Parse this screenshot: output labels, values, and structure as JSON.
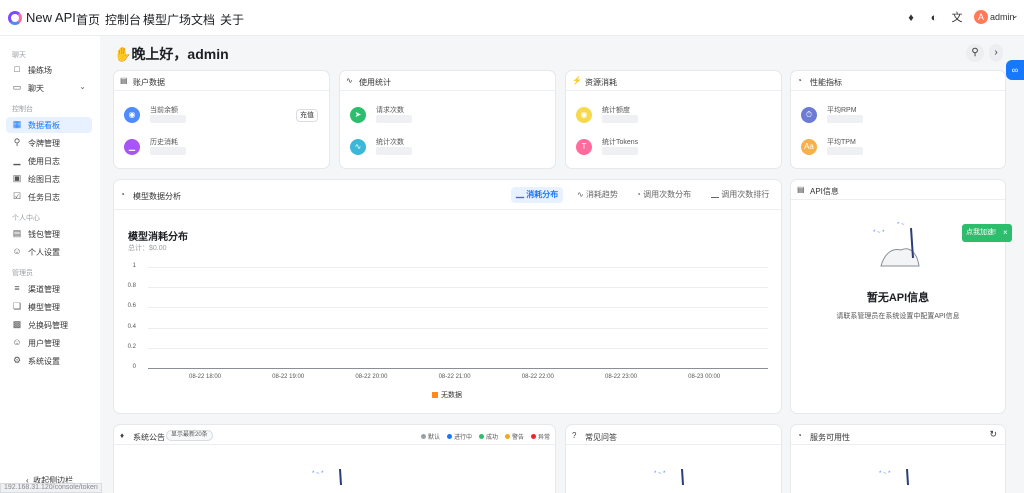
{
  "header": {
    "brand": "New API",
    "nav": [
      "首页",
      "控制台",
      "模型广场",
      "文档",
      "关于"
    ],
    "user": {
      "avatar_letter": "A",
      "name": "admin"
    },
    "icons": [
      "bell-icon",
      "theme-icon",
      "language-icon"
    ]
  },
  "sidebar": {
    "sections": [
      "聊天",
      "控制台",
      "个人中心",
      "管理员"
    ],
    "items": [
      {
        "label": "操练场",
        "icon": "playground-icon"
      },
      {
        "label": "聊天",
        "icon": "chat-icon"
      },
      {
        "label": "数据看板",
        "icon": "dashboard-icon",
        "active": true
      },
      {
        "label": "令牌管理",
        "icon": "key-icon"
      },
      {
        "label": "使用日志",
        "icon": "chart-icon"
      },
      {
        "label": "绘图日志",
        "icon": "image-icon"
      },
      {
        "label": "任务日志",
        "icon": "task-icon"
      },
      {
        "label": "钱包管理",
        "icon": "wallet-icon"
      },
      {
        "label": "个人设置",
        "icon": "user-icon"
      },
      {
        "label": "渠道管理",
        "icon": "layers-icon"
      },
      {
        "label": "模型管理",
        "icon": "box-icon"
      },
      {
        "label": "兑换码管理",
        "icon": "gift-icon"
      },
      {
        "label": "用户管理",
        "icon": "user-icon"
      },
      {
        "label": "系统设置",
        "icon": "gear-icon"
      }
    ],
    "collapse_label": "收起侧边栏",
    "url_tooltip": "192.168.31.120/console/token"
  },
  "greeting": "晚上好，admin",
  "cards": {
    "account": {
      "title": "账户数据",
      "stats": [
        "当前余额",
        "历史消耗"
      ],
      "recharge": "充值"
    },
    "usage": {
      "title": "使用统计",
      "stats": [
        "请求次数",
        "统计次数"
      ]
    },
    "resource": {
      "title": "资源消耗",
      "stats": [
        "统计额度",
        "统计Tokens"
      ]
    },
    "performance": {
      "title": "性能指标",
      "stats": [
        "平均RPM",
        "平均TPM"
      ]
    }
  },
  "analysis": {
    "title": "模型数据分析",
    "tabs": [
      "消耗分布",
      "消耗趋势",
      "调用次数分布",
      "调用次数排行"
    ],
    "active_tab": 0
  },
  "chart_data": {
    "type": "line",
    "title": "模型消耗分布",
    "subtitle": "总计：$0.00",
    "x": [
      "08-22 18:00",
      "08-22 19:00",
      "08-22 20:00",
      "08-22 21:00",
      "08-22 22:00",
      "08-22 23:00",
      "08-23 00:00"
    ],
    "y_ticks": [
      "1",
      "0.8",
      "0.6",
      "0.4",
      "0.2",
      "0"
    ],
    "ylim": [
      0,
      1
    ],
    "grid": true,
    "legend": [
      "无数据"
    ],
    "legend_position": "bottom",
    "series": [
      {
        "name": "无数据",
        "color": "#ff8c1a",
        "values": []
      }
    ]
  },
  "api_info": {
    "title": "API信息",
    "empty_title": "暂无API信息",
    "empty_desc": "请联系管理员在系统设置中配置API信息"
  },
  "toast": "点我加速!",
  "announcements": {
    "title": "系统公告",
    "chip": "显示最新20条",
    "legend": [
      {
        "label": "默认",
        "color": "#9aa0a6"
      },
      {
        "label": "进行中",
        "color": "#1677ff"
      },
      {
        "label": "成功",
        "color": "#2cbe6c"
      },
      {
        "label": "警告",
        "color": "#f5a623"
      },
      {
        "label": "异常",
        "color": "#f5222d"
      }
    ]
  },
  "faq": {
    "title": "常见问答"
  },
  "service": {
    "title": "服务可用性"
  }
}
